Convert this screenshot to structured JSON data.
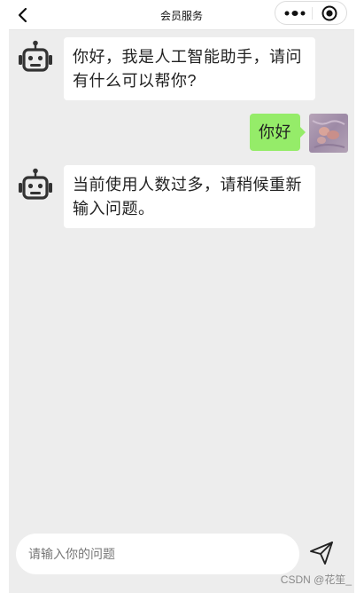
{
  "header": {
    "title": "会员服务",
    "back_icon": "chevron-left-icon",
    "more_icon": "more-dots-icon",
    "close_icon": "record-close-icon"
  },
  "messages": [
    {
      "role": "bot",
      "avatar_icon": "robot-icon",
      "text_lines": [
        "你好，我是人工智能助手，请问",
        "有什么可以帮你?"
      ]
    },
    {
      "role": "user",
      "avatar": "user-avatar",
      "text": "你好"
    },
    {
      "role": "bot",
      "avatar_icon": "robot-icon",
      "text_lines": [
        "当前使用人数过多，请稍候重新",
        "输入问题。"
      ]
    }
  ],
  "input": {
    "placeholder": "请输入你的问题",
    "value": ""
  },
  "send_icon": "send-icon",
  "watermark": "CSDN @花笙_",
  "colors": {
    "chat_background": "#ededed",
    "user_bubble": "#95ec69",
    "bot_bubble": "#ffffff",
    "header_background": "#ffffff"
  }
}
